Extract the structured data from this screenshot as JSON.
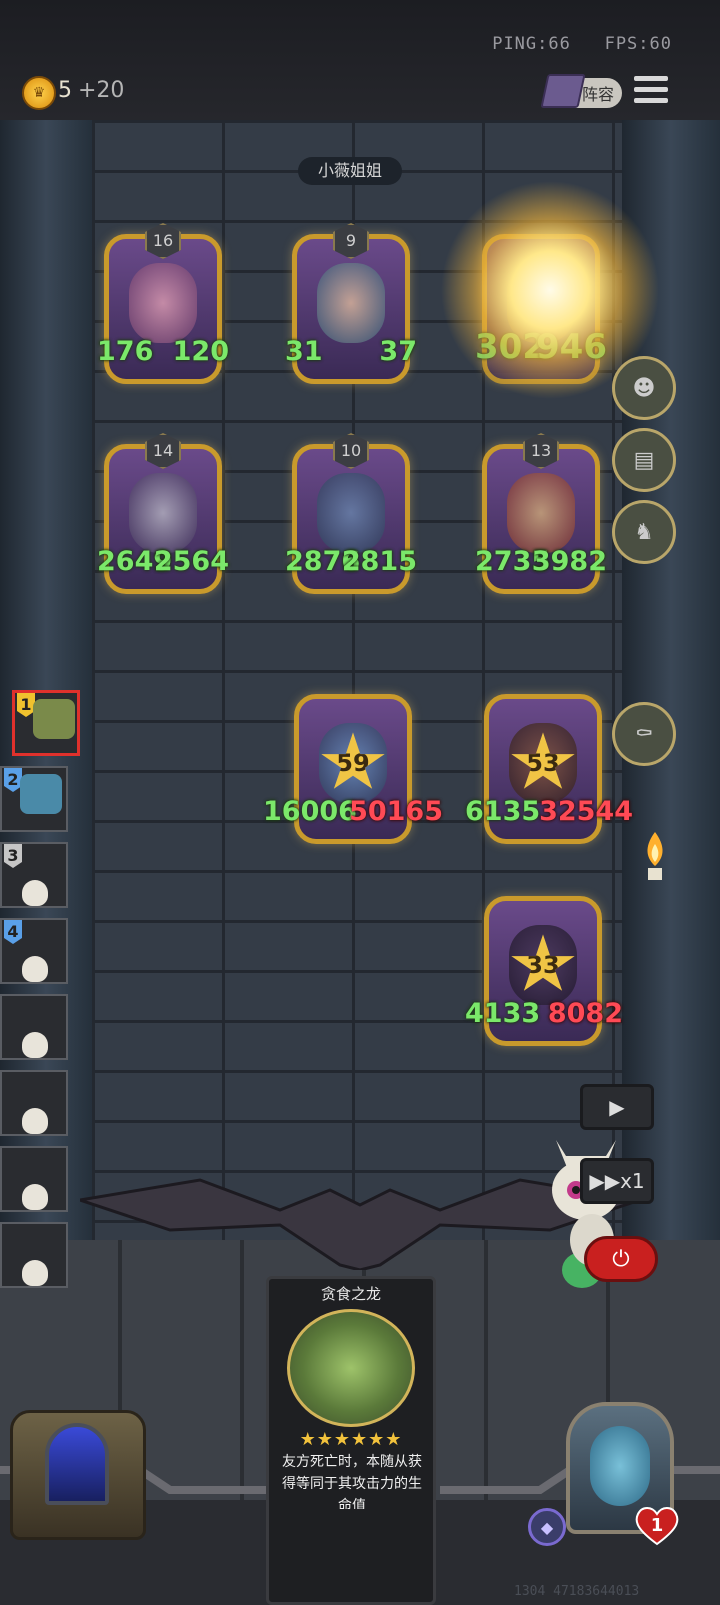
{
  "status": {
    "ping": "PING:66",
    "fps": "FPS:60"
  },
  "gold": {
    "value": "5",
    "bonus": "+20"
  },
  "lineup_button": {
    "label": "阵容"
  },
  "opponent": {
    "name": "小薇姐姐"
  },
  "opponent_board": [
    {
      "tier": "16",
      "attack": "176",
      "health": "120"
    },
    {
      "tier": "9",
      "attack": "31",
      "health": "37"
    },
    {
      "tier": "",
      "attack": "302",
      "health": "946"
    },
    {
      "tier": "14",
      "attack": "2649",
      "health": "2564"
    },
    {
      "tier": "10",
      "attack": "2876",
      "health": "2815"
    },
    {
      "tier": "13",
      "attack": "2735",
      "health": "3982"
    }
  ],
  "player_board": [
    {
      "level": "59",
      "attack": "16006",
      "health": "50165"
    },
    {
      "level": "53",
      "attack": "6135",
      "health": "32544"
    },
    {
      "level": "33",
      "attack": "4133",
      "health": "8082"
    }
  ],
  "turn_order": [
    {
      "number": "1",
      "eliminated": false
    },
    {
      "number": "2",
      "eliminated": false
    },
    {
      "number": "3",
      "eliminated": true
    },
    {
      "number": "4",
      "eliminated": true
    },
    {
      "number": "",
      "eliminated": true
    },
    {
      "number": "",
      "eliminated": true
    },
    {
      "number": "",
      "eliminated": true
    },
    {
      "number": "",
      "eliminated": true
    }
  ],
  "controls": {
    "play_icon": "play-icon",
    "speed_label": "▶▶x1",
    "power_icon": "power-icon"
  },
  "card_tooltip": {
    "name": "贪食之龙",
    "stars": "★★★★★★",
    "description": "友方死亡时，本随从获得等同于其攻击力的生命值"
  },
  "player": {
    "lives": "1"
  },
  "footer": {
    "id": "1304 47183644013"
  },
  "colors": {
    "stat_green": "#7be86a",
    "stat_red": "#ff4a55",
    "gold_frame": "#c99a2c",
    "power_red": "#c9201f"
  }
}
